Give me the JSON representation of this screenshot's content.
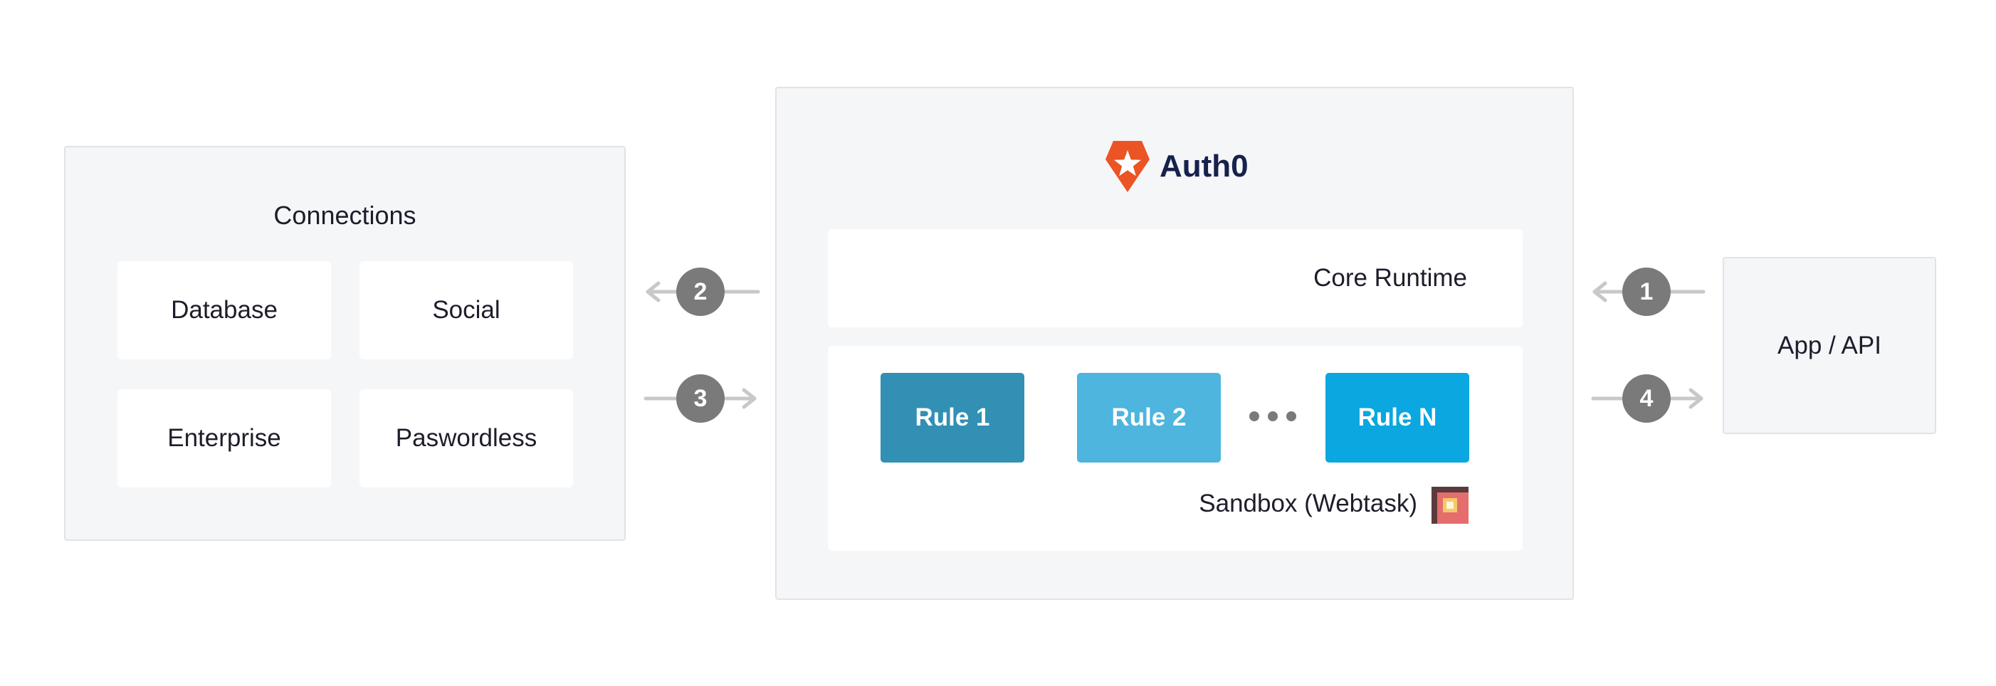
{
  "connections": {
    "title": "Connections",
    "items": [
      {
        "label": "Database"
      },
      {
        "label": "Social"
      },
      {
        "label": "Enterprise"
      },
      {
        "label": "Paswordless"
      }
    ]
  },
  "auth0": {
    "brand": "Auth0",
    "core_runtime": "Core Runtime",
    "rules": [
      {
        "label": "Rule 1",
        "color": "#3190b3"
      },
      {
        "label": "Rule 2",
        "color": "#4db5de"
      },
      {
        "label": "Rule N",
        "color": "#0aa7e0"
      }
    ],
    "sandbox": "Sandbox (Webtask)"
  },
  "app": {
    "label": "App / API"
  },
  "steps": [
    {
      "number": "1"
    },
    {
      "number": "2"
    },
    {
      "number": "3"
    },
    {
      "number": "4"
    }
  ],
  "colors": {
    "panel": "#f5f6f8",
    "brand_orange": "#eb5424",
    "step_badge": "#7a7a7a",
    "arrow": "#c8c8c8"
  }
}
